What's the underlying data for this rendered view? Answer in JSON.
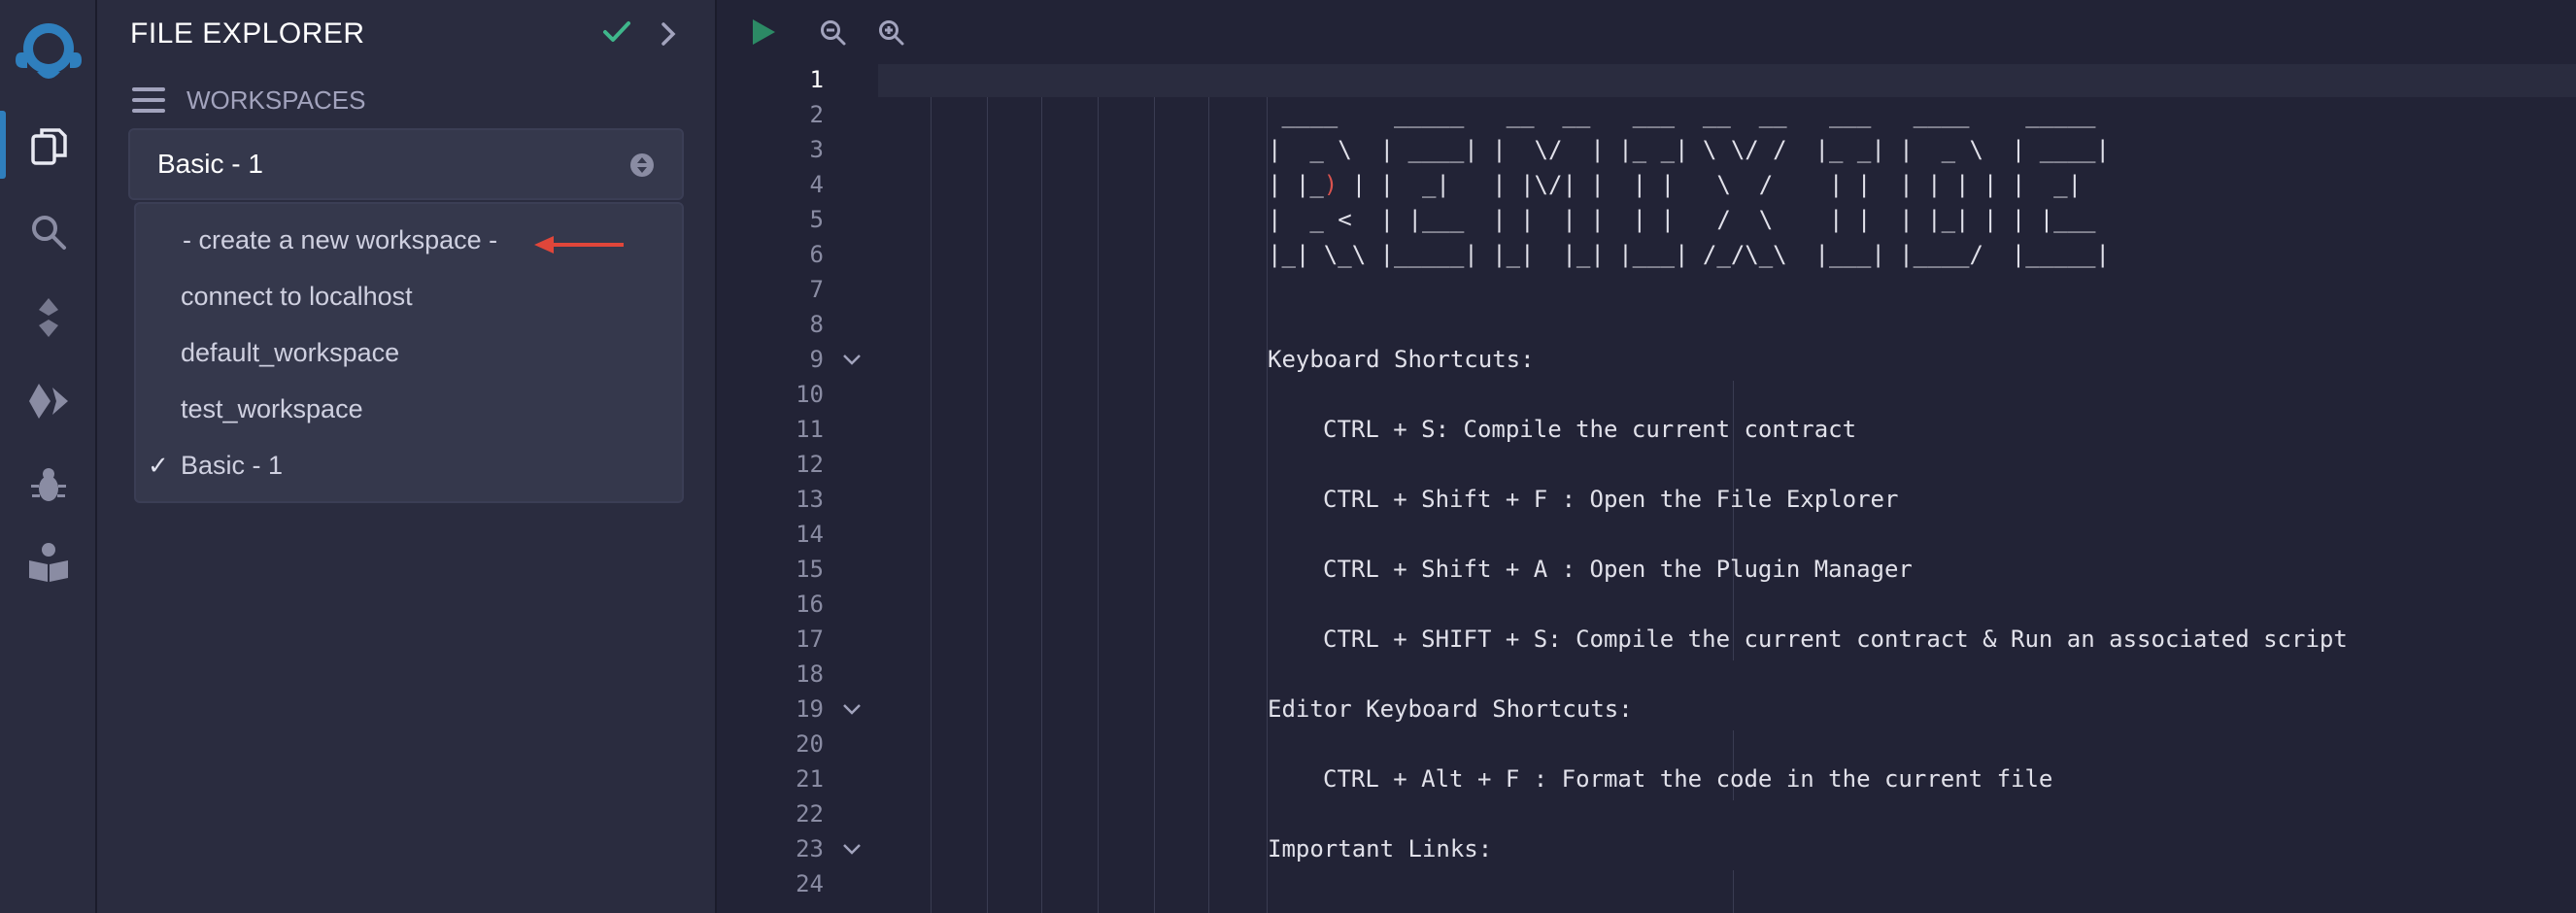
{
  "rail": {
    "icons": [
      "remix-logo-icon",
      "file-explorer-icon",
      "search-icon",
      "solidity-compiler-icon",
      "deploy-run-icon",
      "debugger-icon",
      "learneth-icon"
    ]
  },
  "panel": {
    "title": "FILE EXPLORER",
    "workspaces_label": "WORKSPACES",
    "selected_workspace": "Basic - 1",
    "dropdown_items": [
      {
        "label": "- create a new workspace -",
        "checked": false
      },
      {
        "label": "connect to localhost",
        "checked": false
      },
      {
        "label": "default_workspace",
        "checked": false
      },
      {
        "label": "test_workspace",
        "checked": false
      },
      {
        "label": "Basic - 1",
        "checked": true
      }
    ],
    "check_mark": "✓"
  },
  "editor": {
    "current_line": 1,
    "line_numbers": [
      "1",
      "2",
      "3",
      "4",
      "5",
      "6",
      "7",
      "8",
      "9",
      "10",
      "11",
      "12",
      "13",
      "14",
      "15",
      "16",
      "17",
      "18",
      "19",
      "20",
      "21",
      "22",
      "23",
      "24"
    ],
    "folded_lines": [
      9,
      19,
      23
    ],
    "ascii_art": {
      "line2": " ____    _____   __  __   ___  __  __   ___   ____    _____",
      "line3": "|  _ \\  | ____| |  \\/  | |_ _| \\ \\/ /  |_ _| |  _ \\  | ____|",
      "line4a": "| |_",
      "line4red": ")",
      "line4b": " | |  _|   | |\\/| |  | |   \\  /    | |  | | | | |  _|",
      "line5": "|  _ <  | |___  | |  | |  | |   /  \\    | |  | |_| | | |___",
      "line6": "|_| \\_\\ |_____| |_|  |_| |___| /_/\\_\\  |___| |____/  |_____|"
    },
    "keyboard_shortcuts_heading": "Keyboard Shortcuts:",
    "shortcut_1": "CTRL + S: Compile the current contract",
    "shortcut_2": "CTRL + Shift + F : Open the File Explorer",
    "shortcut_3": "CTRL + Shift + A : Open the Plugin Manager",
    "shortcut_4": "CTRL + SHIFT + S: Compile the current contract & Run an associated script",
    "editor_shortcuts_heading": "Editor Keyboard Shortcuts:",
    "editor_shortcut_1": "CTRL + Alt + F : Format the code in the current file",
    "important_links_heading": "Important Links:"
  },
  "colors": {
    "accent_blue": "#2f7fbd",
    "success_green": "#3fb68b",
    "arrow_red": "#e0463a",
    "background": "#222336",
    "panel": "#2a2c3f"
  }
}
